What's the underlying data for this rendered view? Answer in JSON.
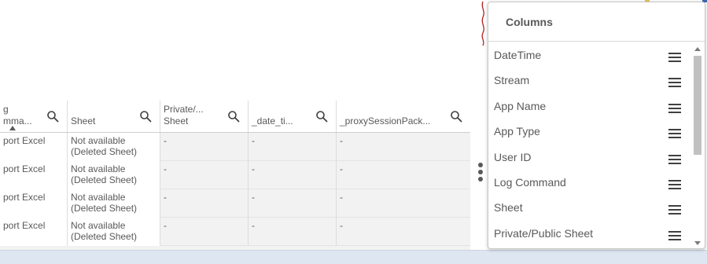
{
  "table": {
    "headers": [
      {
        "label": "g\nmma...",
        "sort": "asc"
      },
      {
        "label": "Sheet"
      },
      {
        "label": "Private/...\nSheet"
      },
      {
        "label": "_date_ti..."
      },
      {
        "label": "_proxySessionPack..."
      }
    ],
    "rows": [
      [
        "port Excel",
        "Not available\n(Deleted Sheet)",
        "-",
        "-",
        "-"
      ],
      [
        "port Excel",
        "Not available\n(Deleted Sheet)",
        "-",
        "-",
        "-"
      ],
      [
        "port Excel",
        "Not available\n(Deleted Sheet)",
        "-",
        "-",
        "-"
      ],
      [
        "port Excel",
        "Not available\n(Deleted Sheet)",
        "-",
        "-",
        "-"
      ]
    ]
  },
  "columns_panel": {
    "title": "Columns",
    "items": [
      "DateTime",
      "Stream",
      "App Name",
      "App Type",
      "User ID",
      "Log Command",
      "Sheet",
      "Private/Public Sheet"
    ]
  },
  "icons": {
    "header_search": "search-icon",
    "drag_handle": "drag-handle-icon",
    "more": "vertical-ellipsis-icon"
  },
  "colors": {
    "table_bg": "#f2f2f2",
    "bottom_bar": "#dde6f1",
    "text": "#595959"
  }
}
